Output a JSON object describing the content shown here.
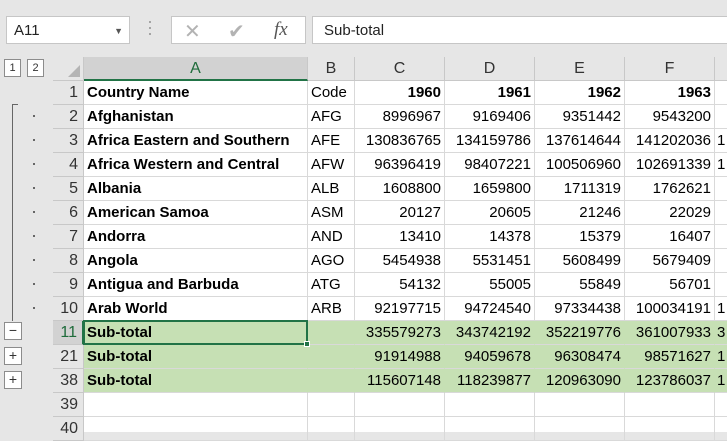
{
  "name_box": {
    "value": "A11"
  },
  "formula_bar": {
    "content": "Sub-total",
    "cancel_icon": "✕",
    "enter_icon": "✔",
    "fx_label": "fx"
  },
  "outline": {
    "levels": [
      "1",
      "2"
    ],
    "collapse_symbol": "−",
    "expand_symbol": "+"
  },
  "columns": [
    "A",
    "B",
    "C",
    "D",
    "E",
    "F"
  ],
  "selected_column": "A",
  "rows": [
    {
      "num": "1",
      "cells": [
        "Country Name",
        "Code",
        "1960",
        "1961",
        "1962",
        "1963"
      ]
    },
    {
      "num": "2",
      "cells": [
        "Afghanistan",
        "AFG",
        "8996967",
        "9169406",
        "9351442",
        "9543200"
      ]
    },
    {
      "num": "3",
      "cells": [
        "Africa Eastern and Southern",
        "AFE",
        "130836765",
        "134159786",
        "137614644",
        "141202036"
      ],
      "overflow": "1"
    },
    {
      "num": "4",
      "cells": [
        "Africa Western and Central",
        "AFW",
        "96396419",
        "98407221",
        "100506960",
        "102691339"
      ],
      "overflow": "1"
    },
    {
      "num": "5",
      "cells": [
        "Albania",
        "ALB",
        "1608800",
        "1659800",
        "1711319",
        "1762621"
      ]
    },
    {
      "num": "6",
      "cells": [
        "American Samoa",
        "ASM",
        "20127",
        "20605",
        "21246",
        "22029"
      ]
    },
    {
      "num": "7",
      "cells": [
        "Andorra",
        "AND",
        "13410",
        "14378",
        "15379",
        "16407"
      ]
    },
    {
      "num": "8",
      "cells": [
        "Angola",
        "AGO",
        "5454938",
        "5531451",
        "5608499",
        "5679409"
      ]
    },
    {
      "num": "9",
      "cells": [
        "Antigua and Barbuda",
        "ATG",
        "54132",
        "55005",
        "55849",
        "56701"
      ]
    },
    {
      "num": "10",
      "cells": [
        "Arab World",
        "ARB",
        "92197715",
        "94724540",
        "97334438",
        "100034191"
      ],
      "overflow": "1"
    },
    {
      "num": "11",
      "cells": [
        "Sub-total",
        "",
        "335579273",
        "343742192",
        "352219776",
        "361007933"
      ],
      "overflow": "3",
      "subtotal": true
    },
    {
      "num": "21",
      "cells": [
        "Sub-total",
        "",
        "91914988",
        "94059678",
        "96308474",
        "98571627"
      ],
      "overflow": "1",
      "subtotal": true
    },
    {
      "num": "38",
      "cells": [
        "Sub-total",
        "",
        "115607148",
        "118239877",
        "120963090",
        "123786037"
      ],
      "overflow": "1",
      "subtotal": true
    },
    {
      "num": "39",
      "cells": [
        "",
        "",
        "",
        "",
        "",
        ""
      ]
    },
    {
      "num": "40",
      "cells": [
        "",
        "",
        "",
        "",
        "",
        ""
      ]
    }
  ],
  "colors": {
    "subtotal_fill": "#c6e0b4",
    "selection": "#217346"
  }
}
